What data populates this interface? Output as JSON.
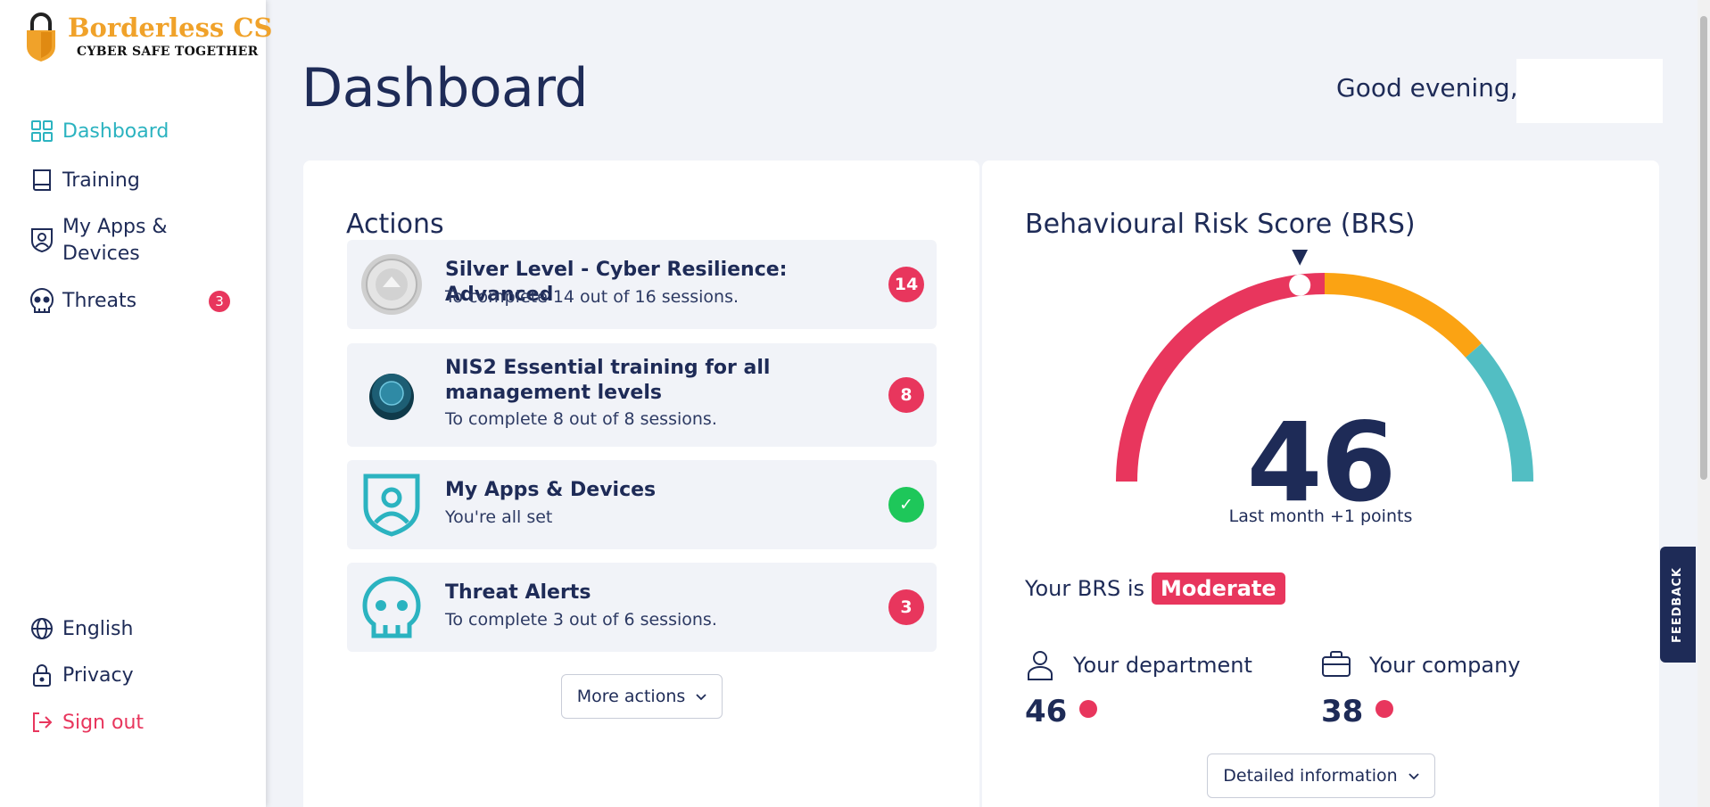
{
  "app": {
    "brand_name": "Borderless CS",
    "brand_tagline": "CYBER SAFE TOGETHER"
  },
  "sidebar": {
    "items": [
      {
        "label": "Dashboard",
        "icon": "grid-icon",
        "active": true
      },
      {
        "label": "Training",
        "icon": "book-icon"
      },
      {
        "label": "My Apps &\nDevices",
        "line1": "My Apps &",
        "line2": "Devices",
        "icon": "shield-user-icon"
      },
      {
        "label": "Threats",
        "icon": "skull-icon",
        "badge": "3"
      }
    ],
    "footer": [
      {
        "label": "English",
        "icon": "globe-icon"
      },
      {
        "label": "Privacy",
        "icon": "lock-icon"
      },
      {
        "label": "Sign out",
        "icon": "sign-out-icon"
      }
    ]
  },
  "header": {
    "title": "Dashboard",
    "greeting": "Good evening,"
  },
  "actions": {
    "title": "Actions",
    "items": [
      {
        "title": "Silver Level - Cyber Resilience: Advanced",
        "subtitle": "To complete 14 out of 16 sessions.",
        "count": "14",
        "icon": "silver-medal-icon"
      },
      {
        "title": "NIS2 Essential training for all management levels",
        "subtitle": "To complete 8 out of 8 sessions.",
        "count": "8",
        "icon": "nis2-badge-icon"
      },
      {
        "title": "My Apps & Devices",
        "subtitle": "You're all set",
        "count": "✓",
        "icon": "shield-user-icon"
      },
      {
        "title": "Threat Alerts",
        "subtitle": "To complete 3 out of 6 sessions.",
        "count": "3",
        "icon": "skull-icon"
      }
    ],
    "more_label": "More actions"
  },
  "brs": {
    "title": "Behavioural Risk Score (BRS)",
    "score": "46",
    "last_month": "Last month +1 points",
    "status_prefix": "Your BRS is",
    "status": "Moderate",
    "department_label": "Your department",
    "department_value": "46",
    "company_label": "Your company",
    "company_value": "38",
    "detail_label": "Detailed information",
    "gauge_fraction": 0.46,
    "colors": {
      "high": "#e8365d",
      "medium": "#fba313",
      "low": "#52bec3"
    }
  },
  "feedback_label": "FEEDBACK"
}
